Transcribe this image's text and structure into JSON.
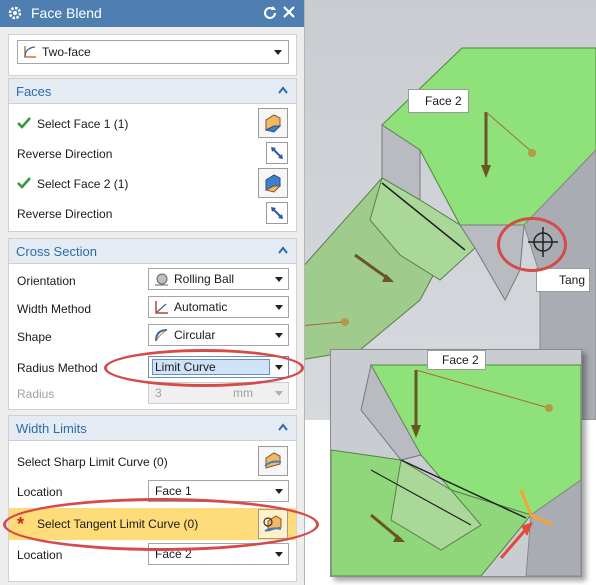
{
  "dialog": {
    "title": "Face Blend",
    "type_value": "Two-face",
    "sections": {
      "faces": {
        "title": "Faces",
        "select_face1": "Select Face 1 (1)",
        "reverse1": "Reverse Direction",
        "select_face2": "Select Face 2 (1)",
        "reverse2": "Reverse Direction"
      },
      "cross_section": {
        "title": "Cross Section",
        "orientation_label": "Orientation",
        "orientation_value": "Rolling Ball",
        "width_method_label": "Width Method",
        "width_method_value": "Automatic",
        "shape_label": "Shape",
        "shape_value": "Circular",
        "radius_method_label": "Radius Method",
        "radius_method_value": "Limit Curve",
        "radius_label": "Radius",
        "radius_value": "3",
        "radius_unit": "mm"
      },
      "width_limits": {
        "title": "Width Limits",
        "sharp_label": "Select Sharp Limit Curve (0)",
        "location1_label": "Location",
        "location1_value": "Face 1",
        "tangent_label": "Select Tangent Limit Curve (0)",
        "location2_label": "Location",
        "location2_value": "Face 2"
      }
    }
  },
  "viewport": {
    "face2_tag": "Face 2",
    "tangent_tag": "Tang"
  },
  "inset": {
    "face2_tag": "Face 2"
  },
  "colors": {
    "title_bar": "#4f7fb0",
    "section_header_text": "#2d6ca8",
    "highlight_row": "#fedc79",
    "annotation": "#d64a4a",
    "face_green": "#8fe17a"
  }
}
